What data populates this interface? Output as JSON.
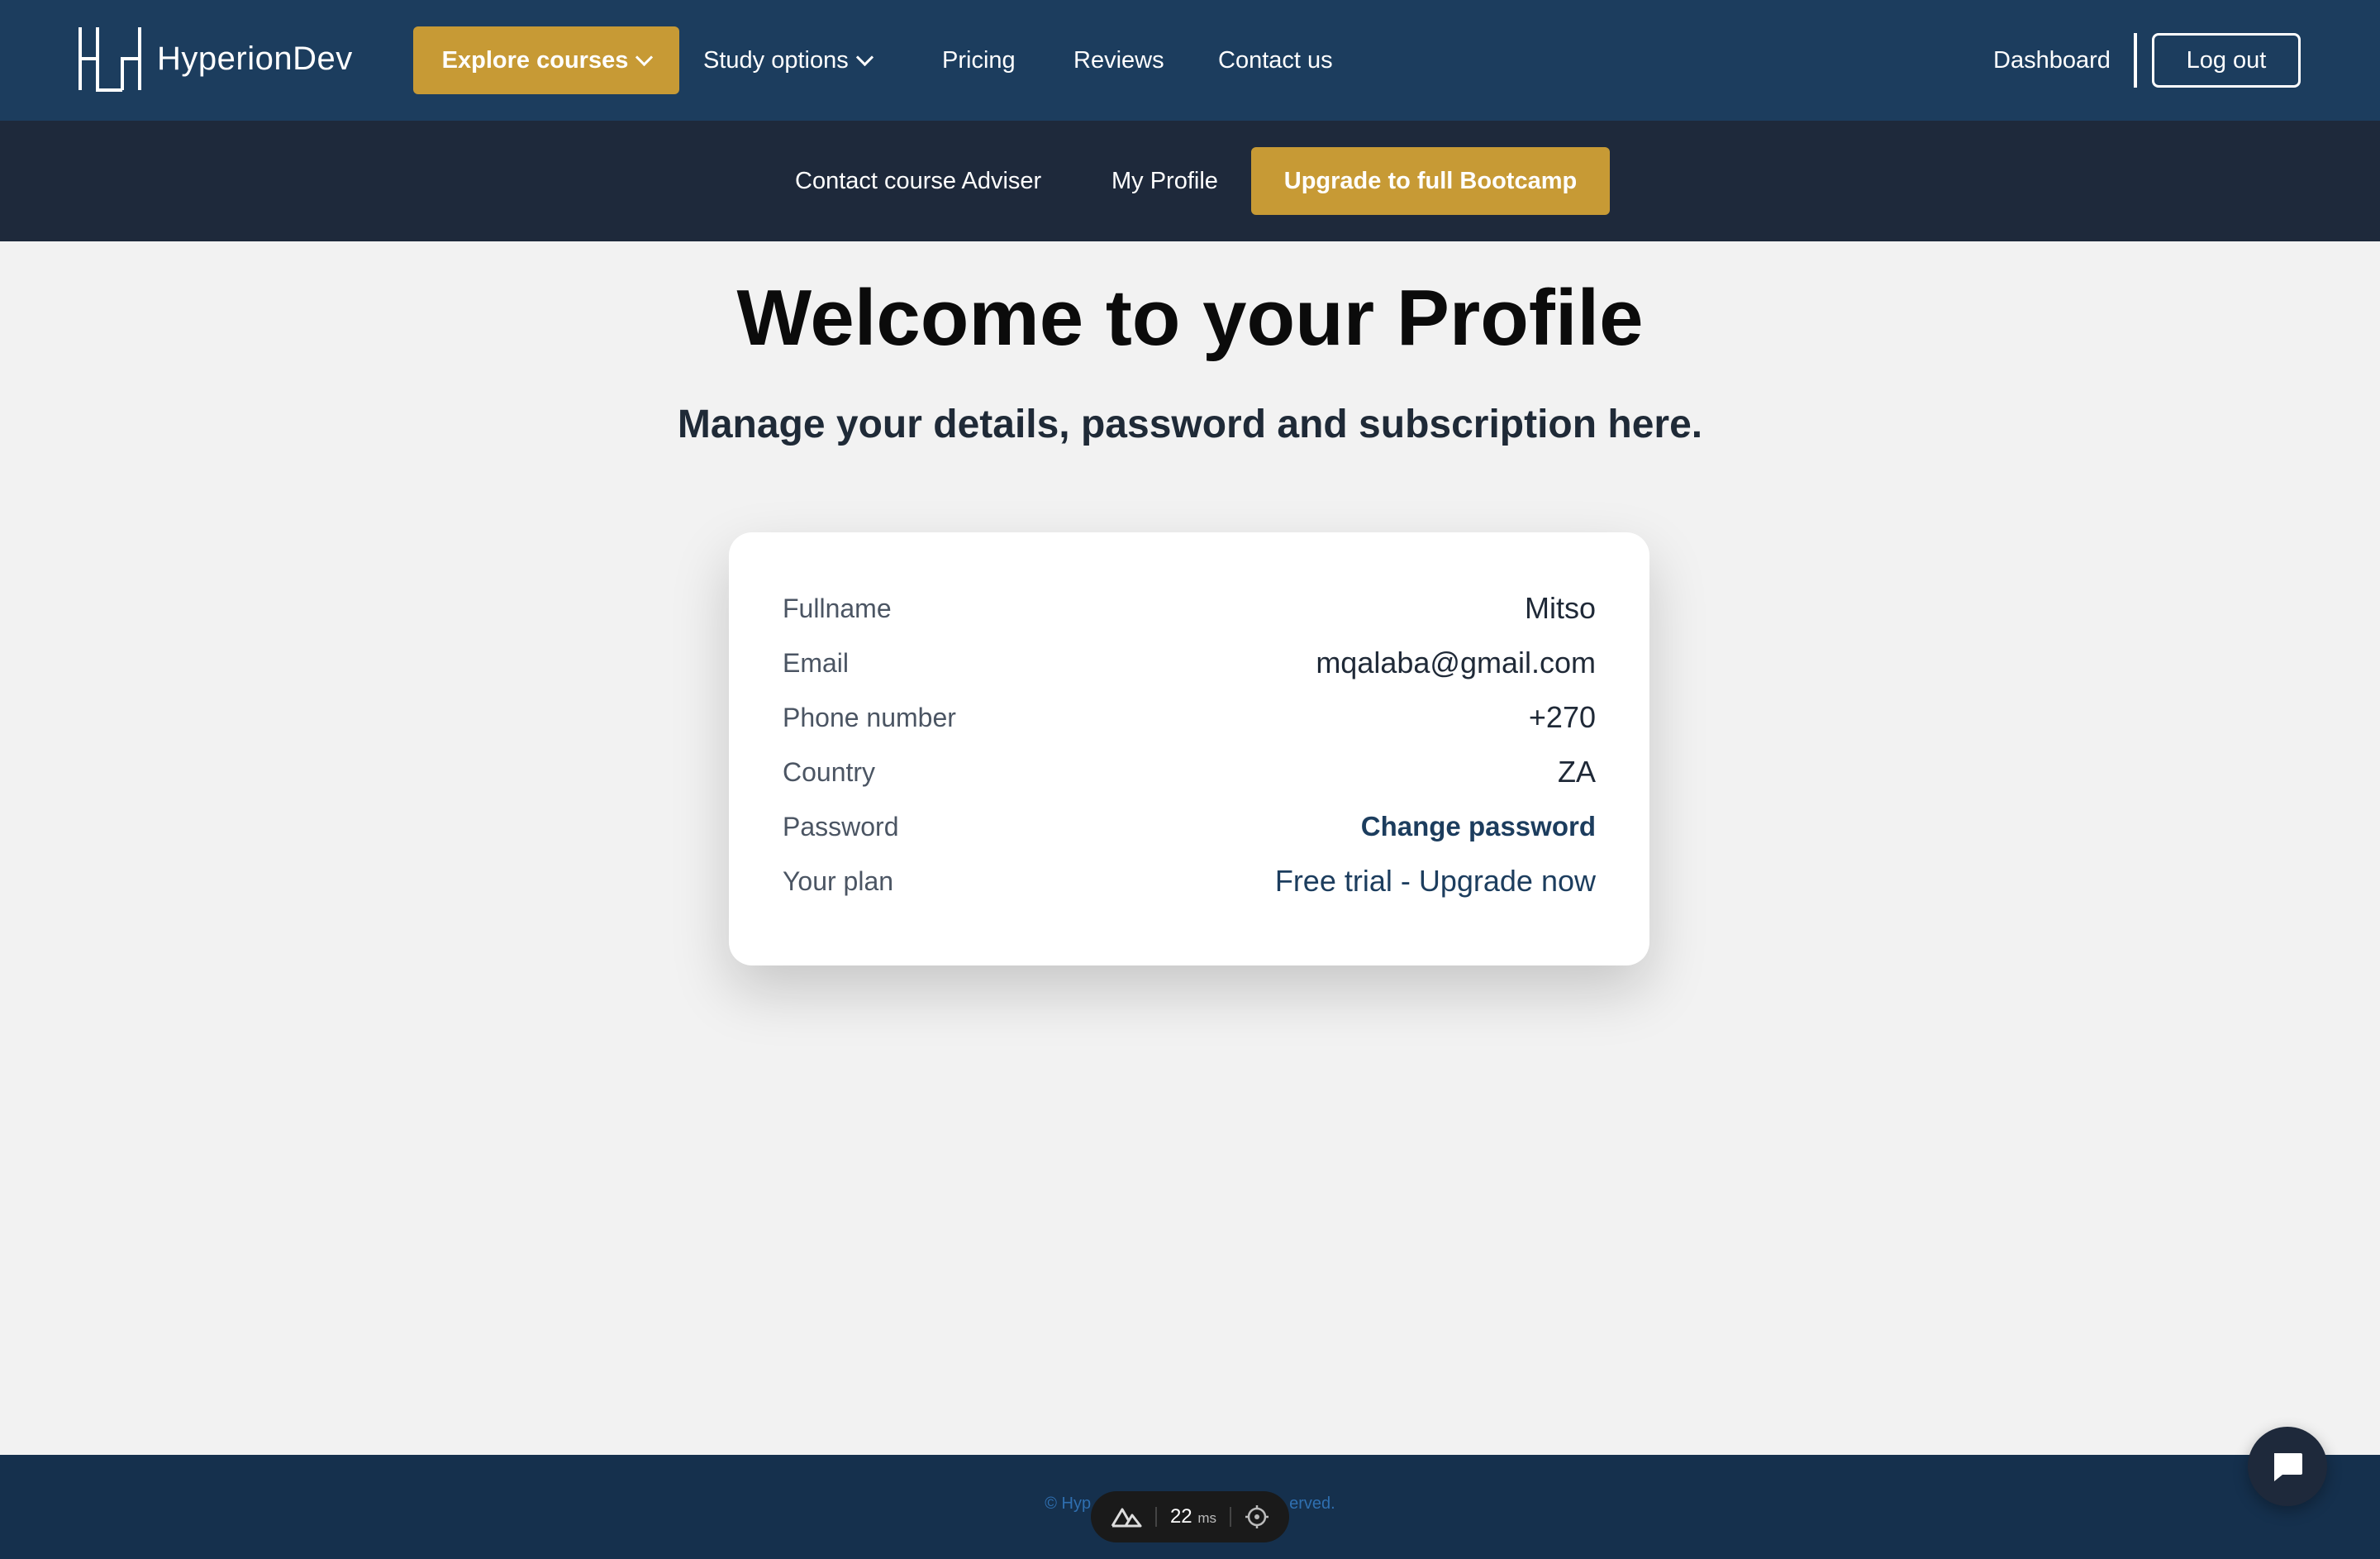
{
  "header": {
    "brand": "HyperionDev",
    "explore_label": "Explore courses",
    "study_label": "Study options",
    "pricing_label": "Pricing",
    "reviews_label": "Reviews",
    "contact_label": "Contact us",
    "dashboard_label": "Dashboard",
    "logout_label": "Log out"
  },
  "subnav": {
    "adviser_label": "Contact course Adviser",
    "profile_label": "My Profile",
    "upgrade_label": "Upgrade to full Bootcamp"
  },
  "main": {
    "title": "Welcome to your Profile",
    "subtitle": "Manage your details, password and subscription here."
  },
  "profile": {
    "fullname_label": "Fullname",
    "fullname_value": "Mitso",
    "email_label": "Email",
    "email_value": "mqalaba@gmail.com",
    "phone_label": "Phone number",
    "phone_value": "+270",
    "country_label": "Country",
    "country_value": "ZA",
    "password_label": "Password",
    "password_link": "Change password",
    "plan_label": "Your plan",
    "plan_link": "Free trial - Upgrade now"
  },
  "footer": {
    "copyright_left": "© Hyp",
    "copyright_right": "erved."
  },
  "devtools": {
    "render_ms": "22",
    "unit": "ms"
  },
  "colors": {
    "nav_bg": "#1c3d5e",
    "subnav_bg": "#1e293b",
    "accent": "#c79a35",
    "page_bg": "#f2f2f2"
  },
  "icons": [
    "hyperiondev-logo-icon",
    "chevron-down-icon",
    "nuxt-icon",
    "crosshair-icon",
    "chat-icon"
  ]
}
